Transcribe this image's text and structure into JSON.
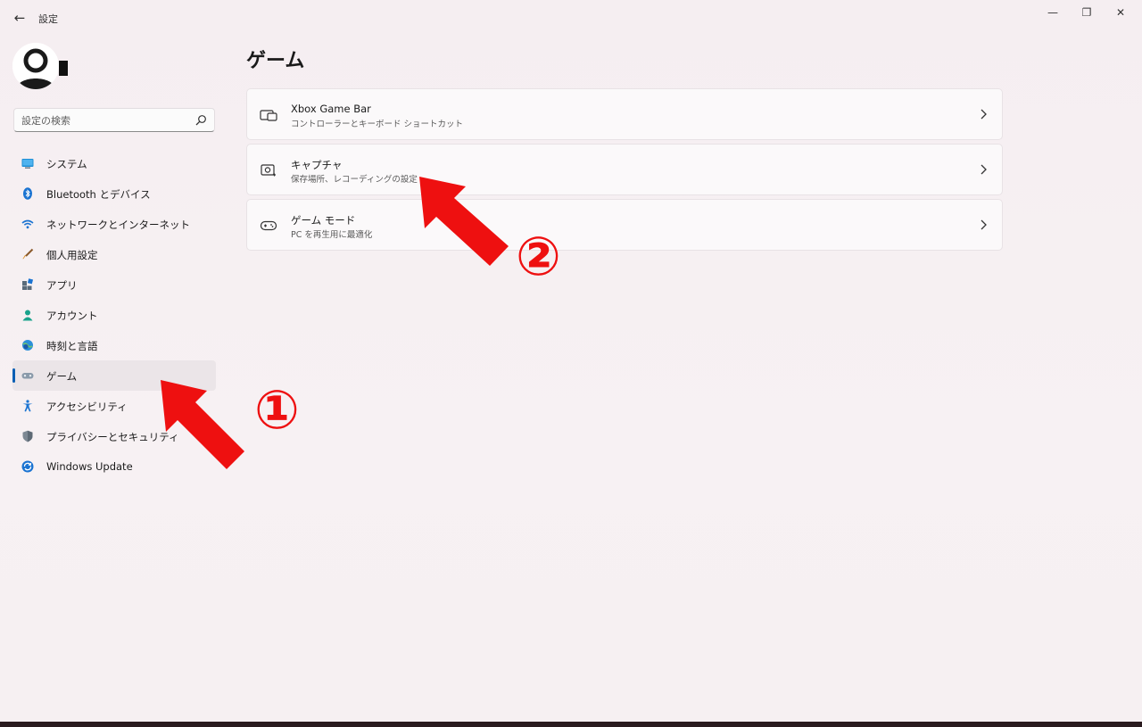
{
  "window": {
    "back_glyph": "←",
    "title": "設定",
    "minimize_glyph": "—",
    "maximize_glyph": "❐",
    "close_glyph": "✕"
  },
  "search": {
    "placeholder": "設定の検索",
    "icon": "search-icon"
  },
  "sidebar": {
    "items": [
      {
        "label": "システム",
        "icon": "monitor-icon",
        "selected": false
      },
      {
        "label": "Bluetooth とデバイス",
        "icon": "bluetooth-icon",
        "selected": false
      },
      {
        "label": "ネットワークとインターネット",
        "icon": "wifi-icon",
        "selected": false
      },
      {
        "label": "個人用設定",
        "icon": "brush-icon",
        "selected": false
      },
      {
        "label": "アプリ",
        "icon": "apps-icon",
        "selected": false
      },
      {
        "label": "アカウント",
        "icon": "account-icon",
        "selected": false
      },
      {
        "label": "時刻と言語",
        "icon": "globe-clock-icon",
        "selected": false
      },
      {
        "label": "ゲーム",
        "icon": "gamepad-icon",
        "selected": true
      },
      {
        "label": "アクセシビリティ",
        "icon": "accessibility-icon",
        "selected": false
      },
      {
        "label": "プライバシーとセキュリティ",
        "icon": "shield-icon",
        "selected": false
      },
      {
        "label": "Windows Update",
        "icon": "update-icon",
        "selected": false
      }
    ]
  },
  "main": {
    "title": "ゲーム",
    "cards": [
      {
        "title": "Xbox Game Bar",
        "subtitle": "コントローラーとキーボード ショートカット",
        "icon": "game-bar-icon"
      },
      {
        "title": "キャプチャ",
        "subtitle": "保存場所、レコーディングの設定",
        "icon": "capture-icon"
      },
      {
        "title": "ゲーム モード",
        "subtitle": "PC を再生用に最適化",
        "icon": "game-mode-icon"
      }
    ]
  },
  "annotations": {
    "step1": "①",
    "step2": "②",
    "color": "#ee1010"
  },
  "colors": {
    "accent": "#0a5fb4",
    "background": "#f6f0f2"
  }
}
